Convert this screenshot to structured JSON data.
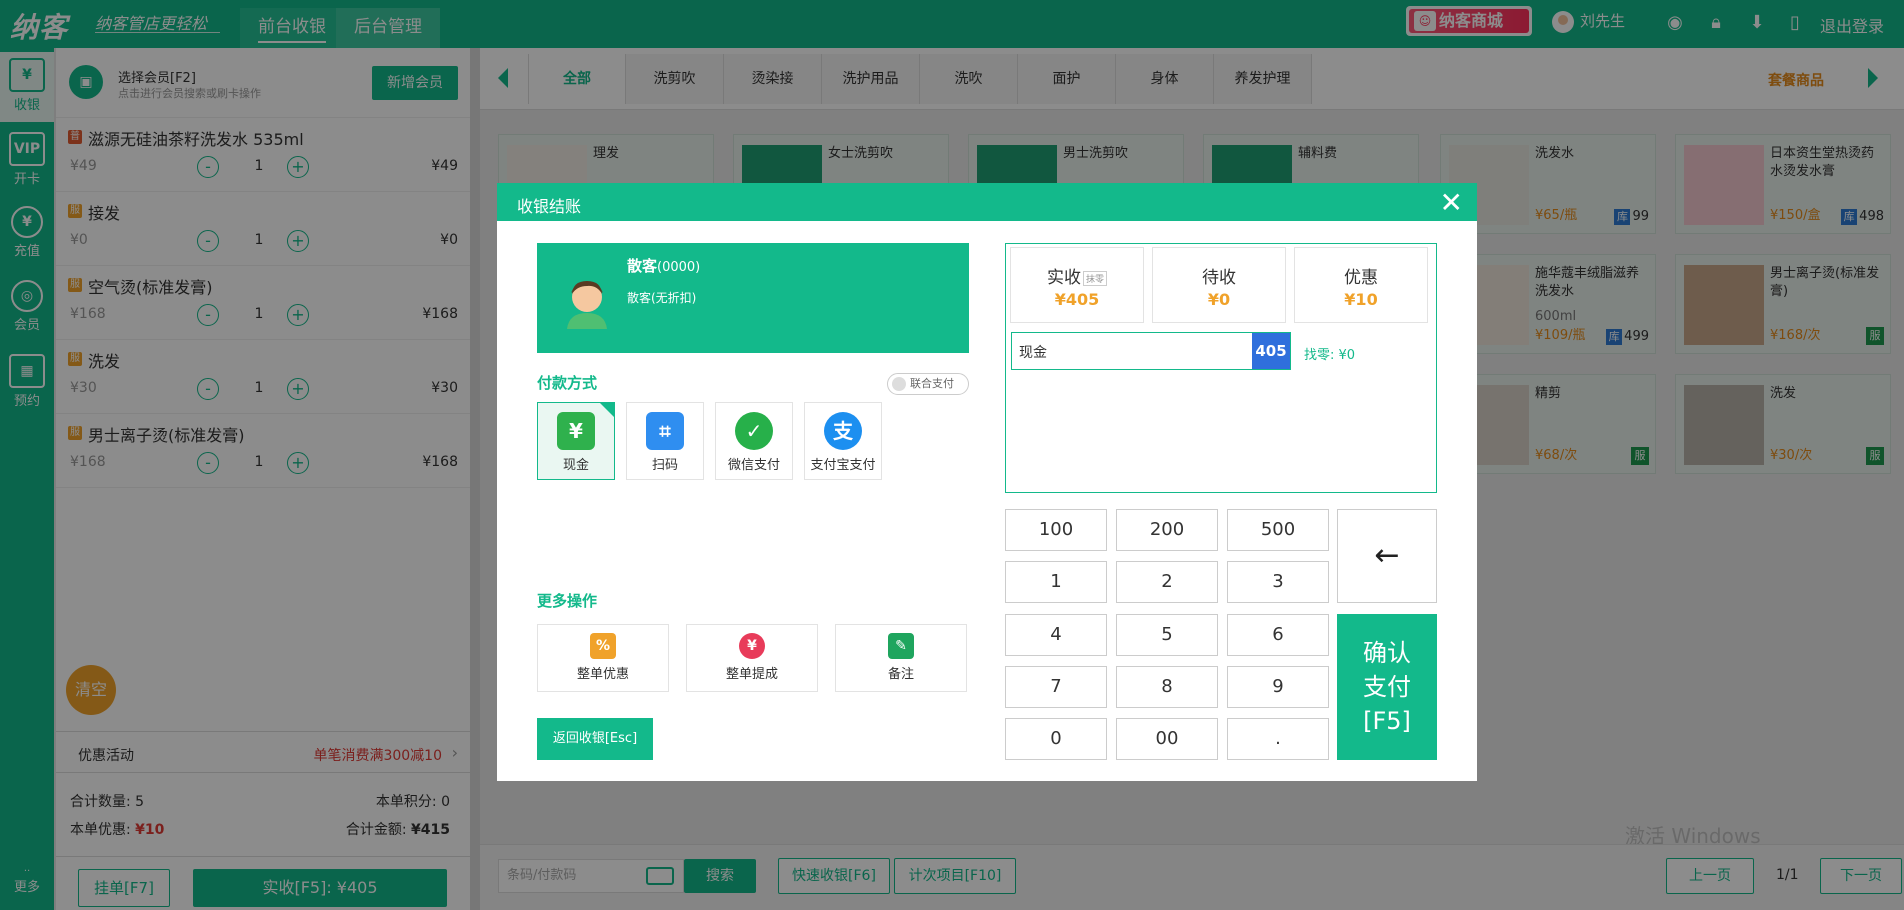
{
  "topbar": {
    "logo": "纳客",
    "slogan": "纳客管店更轻松",
    "tabs": [
      "前台收银",
      "后台管理"
    ],
    "mall": "纳客商城",
    "user": "刘先生",
    "logout": "退出登录",
    "accent": "#13b98b"
  },
  "rail": {
    "items": [
      {
        "icon": "¥",
        "label": "收银"
      },
      {
        "icon": "VIP",
        "label": "开卡"
      },
      {
        "icon": "¥",
        "label": "充值"
      },
      {
        "icon": "◎",
        "label": "会员"
      },
      {
        "icon": "▦",
        "label": "预约"
      }
    ],
    "more": "更多"
  },
  "cart": {
    "member_title": "选择会员[F2]",
    "member_hint": "点击进行会员搜索或刷卡操作",
    "new_member": "新增会员",
    "items": [
      {
        "tag": "普",
        "name": "滋源无硅油茶籽洗发水 535ml",
        "price": "¥49",
        "qty": "1",
        "total": "¥49"
      },
      {
        "tag": "服",
        "name": "接发",
        "price": "¥0",
        "qty": "1",
        "total": "¥0"
      },
      {
        "tag": "服",
        "name": "空气烫(标准发膏)",
        "price": "¥168",
        "qty": "1",
        "total": "¥168"
      },
      {
        "tag": "服",
        "name": "洗发",
        "price": "¥30",
        "qty": "1",
        "total": "¥30"
      },
      {
        "tag": "服",
        "name": "男士离子烫(标准发膏)",
        "price": "¥168",
        "qty": "1",
        "total": "¥168"
      }
    ],
    "minus": "-",
    "plus": "+",
    "clear": "清空",
    "promo_label": "优惠活动",
    "promo_value": "单笔消费满300减10",
    "total_qty_label": "合计数量:",
    "total_qty": "5",
    "points_label": "本单积分:",
    "points": "0",
    "discount_label": "本单优惠:",
    "discount": "¥10",
    "total_label": "合计金额:",
    "total": "¥415",
    "hold": "挂单[F7]",
    "pay": "实收[F5]: ¥405"
  },
  "catalog": {
    "tabs": [
      "全部",
      "洗剪吹",
      "烫染接",
      "洗护用品",
      "洗吹",
      "面护",
      "身体",
      "养发护理"
    ],
    "combo": "套餐商品",
    "cards": [
      {
        "name": "理发",
        "sub": "",
        "price": "",
        "stock": ""
      },
      {
        "name": "女士洗剪吹",
        "sub": "",
        "price": "",
        "stock": ""
      },
      {
        "name": "男士洗剪吹",
        "sub": "",
        "price": "",
        "stock": ""
      },
      {
        "name": "辅料费",
        "sub": "",
        "price": "",
        "stock": ""
      },
      {
        "name": "洗发水",
        "sub": "",
        "price": "¥65/瓶",
        "stock": "99"
      },
      {
        "name": "日本资生堂热烫药水烫发水膏",
        "sub": "",
        "price": "¥150/盒",
        "stock": "498"
      },
      {
        "name": "施华蔻丰绒脂滋养洗发水",
        "sub": "600ml",
        "price": "¥109/瓶",
        "stock": "499"
      },
      {
        "name": "男士离子烫(标准发膏)",
        "sub": "",
        "price": "¥168/次",
        "stock": ""
      },
      {
        "name": "精剪",
        "sub": "",
        "price": "¥68/次",
        "stock": ""
      },
      {
        "name": "洗发",
        "sub": "",
        "price": "¥30/次",
        "stock": ""
      }
    ],
    "stock_tag": "库",
    "service_tag": "服",
    "search_placeholder": "条码/付款码",
    "search": "搜索",
    "quick": "快速收银[F6]",
    "count_items": "计次项目[F10]",
    "prev": "上一页",
    "page": "1/1",
    "next": "下一页",
    "watermark": "激活 Windows"
  },
  "modal": {
    "title": "收银结账",
    "close": "✕",
    "customer_name": "散客",
    "customer_code": "(0000)",
    "customer_discount": "散客(无折扣)",
    "pay_method_title": "付款方式",
    "joint_pay": "联合支付",
    "methods": [
      {
        "label": "现金",
        "icon": "cash-icon",
        "color": "#2fb14d"
      },
      {
        "label": "扫码",
        "icon": "scan-icon",
        "color": "#2f8ef0"
      },
      {
        "label": "微信支付",
        "icon": "wechat-icon",
        "color": "#27b04a"
      },
      {
        "label": "支付宝支付",
        "icon": "alipay-icon",
        "color": "#1c8ff0"
      }
    ],
    "more_title": "更多操作",
    "ops": [
      {
        "label": "整单优惠",
        "color": "#f0a22a"
      },
      {
        "label": "整单提成",
        "color": "#e83b5a"
      },
      {
        "label": "备注",
        "color": "#1fa55e"
      }
    ],
    "back": "返回收银[Esc]",
    "actual_label": "实收",
    "zero_tag": "抹零",
    "actual": "¥405",
    "pending_label": "待收",
    "pending": "¥0",
    "discount_label": "优惠",
    "discount": "¥10",
    "cash_label": "现金",
    "cash_value": "405",
    "change": "找零: ¥0",
    "keys": [
      "100",
      "200",
      "500",
      "1",
      "2",
      "3",
      "4",
      "5",
      "6",
      "7",
      "8",
      "9",
      "0",
      "00",
      "."
    ],
    "backspace": "←",
    "confirm_1": "确认",
    "confirm_2": "支付",
    "confirm_3": "[F5]"
  }
}
